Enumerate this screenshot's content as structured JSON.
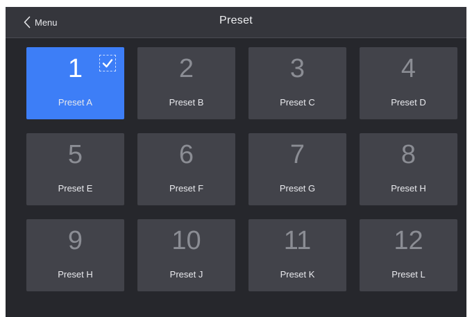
{
  "header": {
    "back_label": "Menu",
    "title": "Preset"
  },
  "presets": [
    {
      "number": "1",
      "label": "Preset A",
      "selected": true
    },
    {
      "number": "2",
      "label": "Preset B",
      "selected": false
    },
    {
      "number": "3",
      "label": "Preset C",
      "selected": false
    },
    {
      "number": "4",
      "label": "Preset D",
      "selected": false
    },
    {
      "number": "5",
      "label": "Preset E",
      "selected": false
    },
    {
      "number": "6",
      "label": "Preset F",
      "selected": false
    },
    {
      "number": "7",
      "label": "Preset G",
      "selected": false
    },
    {
      "number": "8",
      "label": "Preset H",
      "selected": false
    },
    {
      "number": "9",
      "label": "Preset H",
      "selected": false
    },
    {
      "number": "10",
      "label": "Preset J",
      "selected": false
    },
    {
      "number": "11",
      "label": "Preset K",
      "selected": false
    },
    {
      "number": "12",
      "label": "Preset L",
      "selected": false
    }
  ],
  "icons": {
    "back": "chevron-left-icon",
    "check": "checkmark-icon"
  },
  "colors": {
    "background": "#26272c",
    "header": "#35363c",
    "tile": "#42434a",
    "accent": "#3d7ef7"
  }
}
